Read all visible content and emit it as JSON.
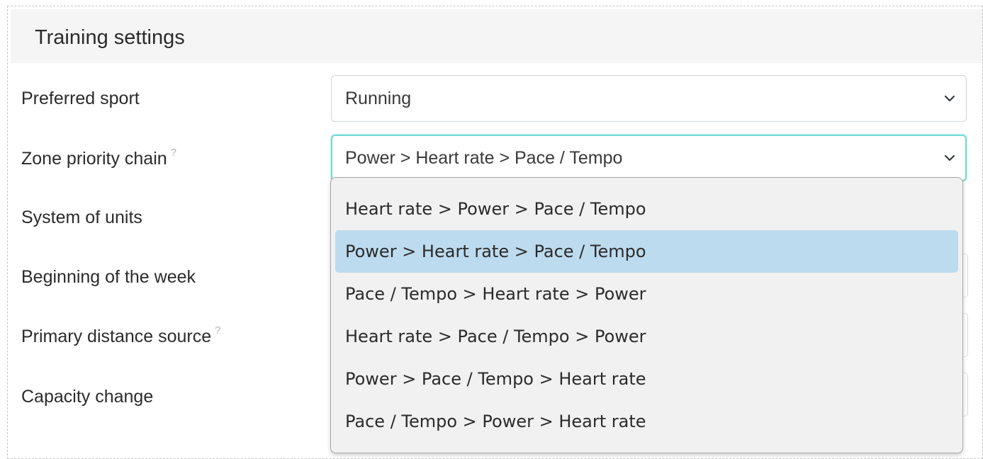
{
  "panel": {
    "title": "Training settings"
  },
  "rows": [
    {
      "label": "Preferred sport",
      "help": ""
    },
    {
      "label": "Zone priority chain",
      "help": "?"
    },
    {
      "label": "System of units",
      "help": ""
    },
    {
      "label": "Beginning of the week",
      "help": ""
    },
    {
      "label": "Primary distance source",
      "help": "?"
    },
    {
      "label": "Capacity change",
      "help": ""
    }
  ],
  "selects": {
    "preferred_sport": {
      "value": "Running",
      "icon": "chevron-down-icon"
    },
    "zone_priority_chain": {
      "value": "Power > Heart rate > Pace / Tempo",
      "icon": "chevron-down-icon"
    }
  },
  "dropdown": {
    "selected_index": 1,
    "options": [
      "Heart rate > Power > Pace / Tempo",
      "Power > Heart rate > Pace / Tempo",
      "Pace / Tempo > Heart rate > Power",
      "Heart rate > Pace / Tempo > Power",
      "Power > Pace / Tempo > Heart rate",
      "Pace / Tempo > Power > Heart rate"
    ]
  },
  "colors": {
    "focus_border": "#6fdcd2",
    "selected_option_bg": "#bddbee",
    "header_bg": "#f5f5f5"
  }
}
